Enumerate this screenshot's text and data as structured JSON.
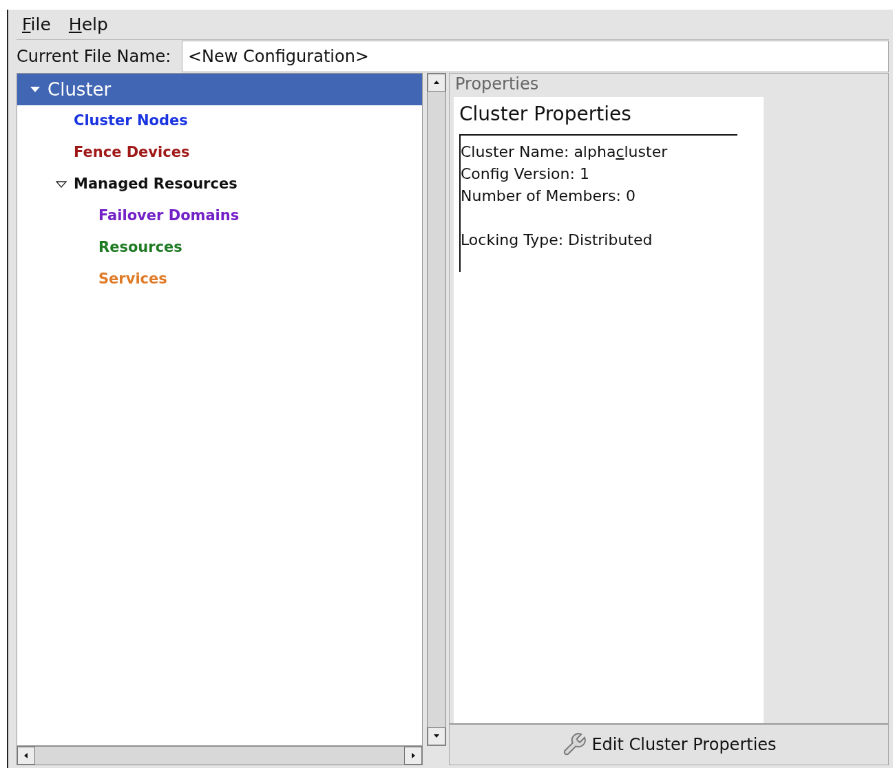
{
  "menu": [
    {
      "key": "F",
      "after": "ile"
    },
    {
      "key": "H",
      "after": "elp"
    }
  ],
  "file_name": {
    "label": "Current File Name:",
    "value": "<New Configuration>"
  },
  "tree": [
    {
      "label": "Cluster",
      "selected": true,
      "expanded": true,
      "color": "#ffffff",
      "children": [
        {
          "label": "Cluster Nodes",
          "selected": false,
          "color": "#1a35e0"
        },
        {
          "label": "Fence Devices",
          "selected": false,
          "color": "#a01818"
        },
        {
          "label": "Managed Resources",
          "selected": false,
          "expanded": true,
          "color": "#111111",
          "children": [
            {
              "label": "Failover Domains",
              "selected": false,
              "color": "#7422c8"
            },
            {
              "label": "Resources",
              "selected": false,
              "color": "#1f7a24"
            },
            {
              "label": "Services",
              "selected": false,
              "color": "#e07a26"
            }
          ]
        }
      ]
    }
  ],
  "properties": {
    "frame_label": "Properties",
    "title": "Cluster Properties",
    "lines": [
      {
        "parts": [
          {
            "text": "Cluster Name: alpha"
          },
          {
            "text": "c",
            "underline": true
          },
          {
            "text": "luster"
          }
        ]
      },
      {
        "parts": [
          {
            "text": "Config Version: 1"
          }
        ]
      },
      {
        "parts": [
          {
            "text": "Number of Members: 0"
          }
        ]
      },
      {
        "parts": [
          {
            "text": "Locking Type: Distributed"
          }
        ],
        "gap_before": true
      }
    ]
  },
  "edit_button": "Edit Cluster Properties"
}
